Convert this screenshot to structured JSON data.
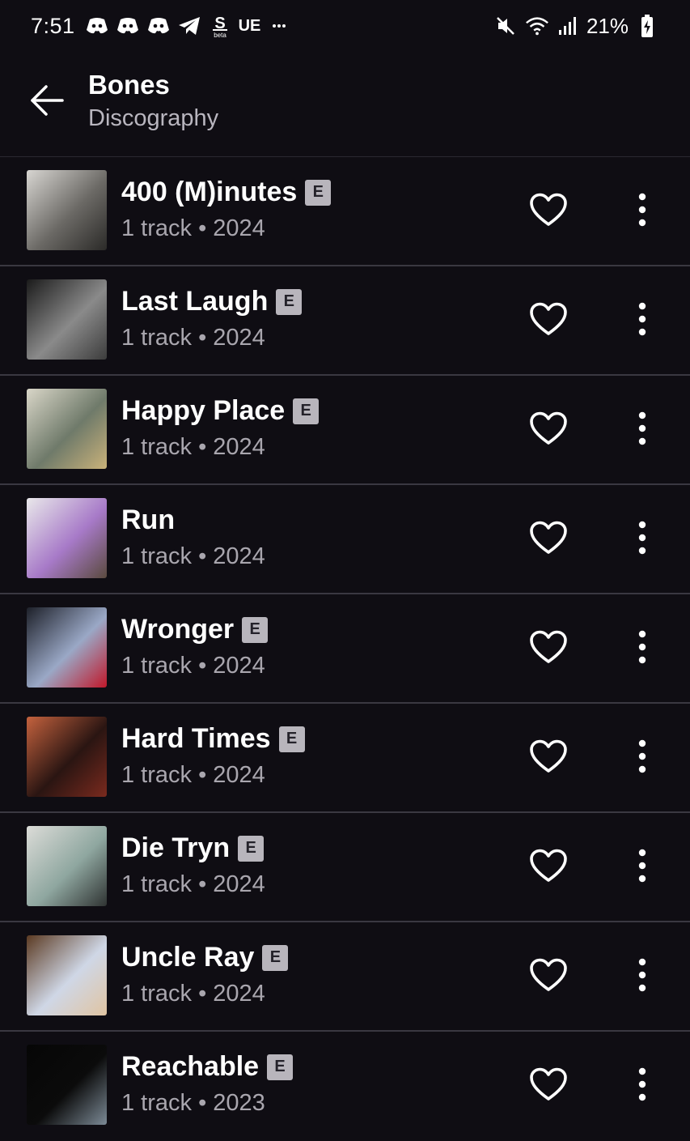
{
  "status_bar": {
    "time": "7:51",
    "carrier_text": "UE",
    "battery_percent": "21%",
    "left_icons": [
      "discord-icon",
      "discord-icon",
      "discord-icon",
      "telegram-icon",
      "sofi-beta-icon"
    ],
    "right_icons": [
      "mute-icon",
      "wifi-icon",
      "signal-icon",
      "battery-icon"
    ]
  },
  "header": {
    "title": "Bones",
    "subtitle": "Discography"
  },
  "explicit_label": "E",
  "albums": [
    {
      "title": "400 (M)inutes",
      "explicit": true,
      "meta": "1 track • 2024",
      "art_colors": [
        "#d8d6d2",
        "#6b6965",
        "#2b2a28"
      ]
    },
    {
      "title": "Last Laugh",
      "explicit": true,
      "meta": "1 track • 2024",
      "art_colors": [
        "#1b1b1b",
        "#8a8a8a",
        "#3c3c3c"
      ]
    },
    {
      "title": "Happy Place",
      "explicit": true,
      "meta": "1 track • 2024",
      "art_colors": [
        "#d9d6c8",
        "#6f7a6a",
        "#c9b27a"
      ]
    },
    {
      "title": "Run",
      "explicit": false,
      "meta": "1 track • 2024",
      "art_colors": [
        "#e9e8ea",
        "#a77ac8",
        "#5a4a3e"
      ]
    },
    {
      "title": "Wronger",
      "explicit": true,
      "meta": "1 track • 2024",
      "art_colors": [
        "#1d2029",
        "#9aa8c6",
        "#c0182a"
      ]
    },
    {
      "title": "Hard Times",
      "explicit": true,
      "meta": "1 track • 2024",
      "art_colors": [
        "#c4623e",
        "#2a1512",
        "#7a2a1e"
      ]
    },
    {
      "title": "Die Tryn",
      "explicit": true,
      "meta": "1 track • 2024",
      "art_colors": [
        "#dcdcd8",
        "#8fa7a0",
        "#2f3332"
      ]
    },
    {
      "title": "Uncle Ray",
      "explicit": true,
      "meta": "1 track • 2024",
      "art_colors": [
        "#5b3a22",
        "#cfd7e6",
        "#e0c4a2"
      ]
    },
    {
      "title": "Reachable",
      "explicit": true,
      "meta": "1 track • 2023",
      "art_colors": [
        "#060606",
        "#0b0b0b",
        "#7c8a96"
      ]
    }
  ]
}
